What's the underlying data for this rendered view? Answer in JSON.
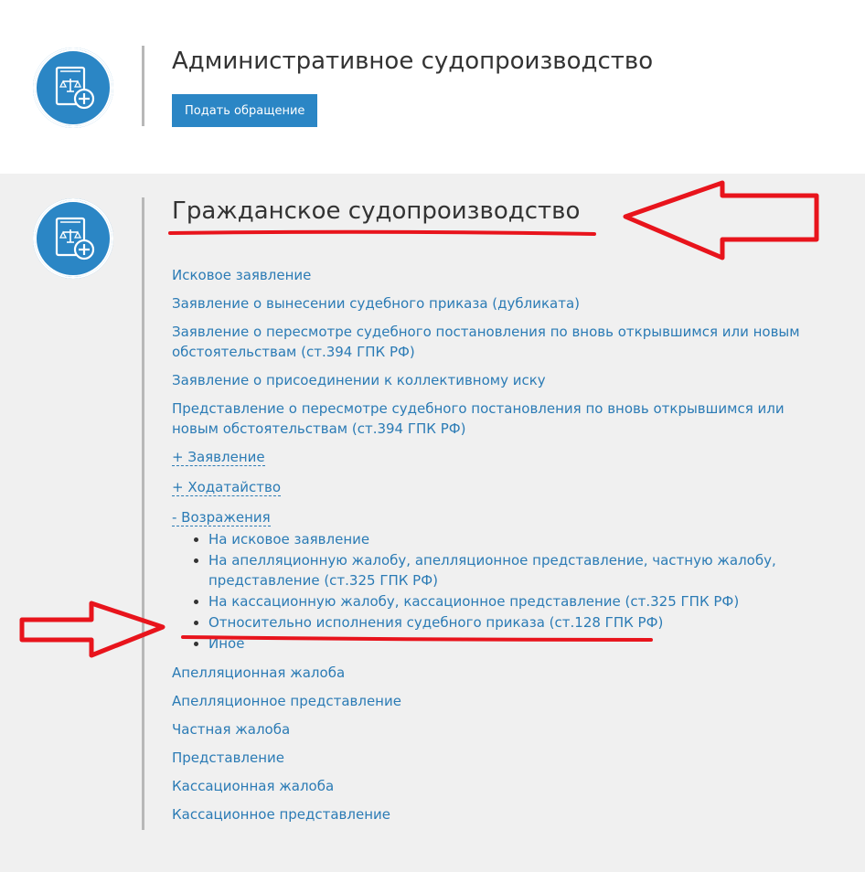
{
  "admin_section": {
    "title": "Административное судопроизводство",
    "button_label": "Подать обращение"
  },
  "civil_section": {
    "title": "Гражданское судопроизводство",
    "links_before": [
      "Исковое заявление",
      "Заявление о вынесении судебного приказа (дубликата)",
      "Заявление о пересмотре судебного постановления по вновь открывшимся или новым обстоятельствам (ст.394 ГПК РФ)",
      "Заявление о присоединении к коллективному иску",
      "Представление о пересмотре судебного постановления по вновь открывшимся или новым обстоятельствам (ст.394 ГПК РФ)"
    ],
    "toggles": [
      "+ Заявление",
      "+ Ходатайство"
    ],
    "objections": {
      "toggle_label": "-  Возражения",
      "items": [
        "На исковое заявление",
        "На апелляционную жалобу, апелляционное представление, частную жалобу, представление (ст.325 ГПК РФ)",
        "На кассационную жалобу, кассационное представление (ст.325 ГПК РФ)",
        "Относительно исполнения судебного приказа (ст.128 ГПК РФ)",
        "Иное"
      ]
    },
    "links_after": [
      "Апелляционная жалоба",
      "Апелляционное представление",
      "Частная жалоба",
      "Представление",
      "Кассационная жалоба",
      "Кассационное представление"
    ]
  },
  "colors": {
    "accent": "#2b86c5",
    "link": "#2b7bb5",
    "annotation": "#e8141c",
    "section_bg": "#f0f0f0"
  },
  "icons": [
    "law-book-add-icon"
  ]
}
